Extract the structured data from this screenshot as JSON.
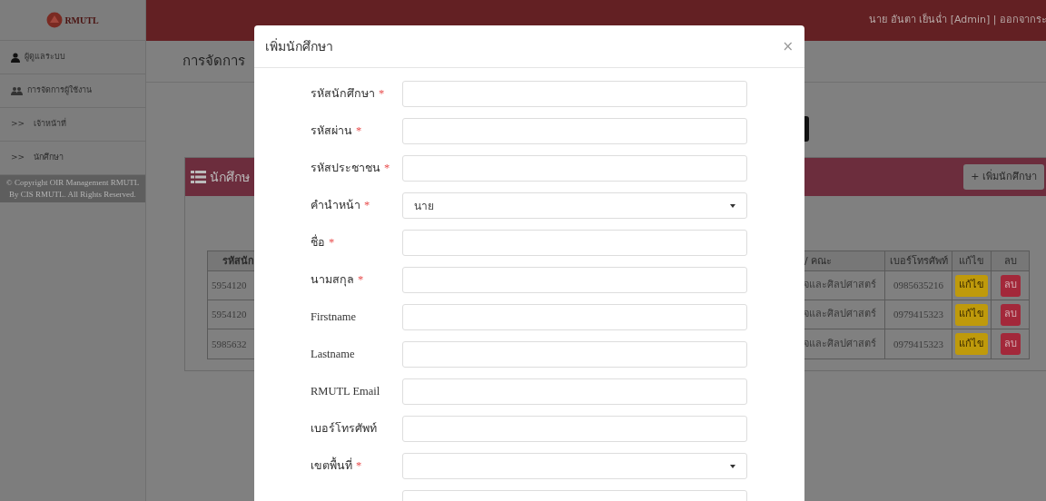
{
  "header": {
    "logo_text": "RMUTL",
    "user": "นาย อันตา เย็นฉ่ำ [Admin] | ออกจากระ"
  },
  "sidebar": {
    "items": [
      {
        "label": "ผู้ดูแลระบบ",
        "kind": "user"
      },
      {
        "label": "การจัดการผู้ใช้งาน",
        "kind": "users"
      },
      {
        "label": "เจ้าหน้าที่",
        "kind": "sub",
        "prefix": ">>"
      },
      {
        "label": "นักศึกษา",
        "kind": "sub",
        "prefix": ">>"
      }
    ],
    "copyright": "© Copyright OIR Management RMUTL By CIS RMUTL. All Rights Reserved."
  },
  "page": {
    "title": "การจัดการ"
  },
  "panel": {
    "title": "นักศึกษ",
    "add_button": "+ เพิ่มนักศึกษา",
    "table": {
      "columns": [
        "รหัสนัก",
        "/ คณะ",
        "เบอร์โทรศัพท์",
        "แก้ไข",
        "ลบ"
      ],
      "rows": [
        {
          "id": "5954120",
          "faculty": "จและศิลปศาสตร์",
          "phone": "0985635216",
          "edit": "แก้ไข",
          "delete": "ลบ"
        },
        {
          "id": "5954120",
          "faculty": "จและศิลปศาสตร์",
          "phone": "0979415323",
          "edit": "แก้ไข",
          "delete": "ลบ"
        },
        {
          "id": "5985632",
          "faculty": "จและศิลปศาสตร์",
          "phone": "0979415323",
          "edit": "แก้ไข",
          "delete": "ลบ"
        }
      ]
    }
  },
  "modal": {
    "title": "เพิ่มนักศึกษา",
    "close": "×",
    "fields": [
      {
        "label": "รหัสนักศึกษา",
        "required_mark": "*",
        "kind": "text"
      },
      {
        "label": "รหัสผ่าน",
        "required_mark": "*",
        "kind": "text"
      },
      {
        "label": "รหัสประชาชน",
        "required_mark": "*",
        "kind": "text"
      },
      {
        "label": "คำนำหน้า",
        "required_mark": "*",
        "kind": "select",
        "value": "นาย"
      },
      {
        "label": "ชื่อ",
        "required_mark": "*",
        "kind": "text"
      },
      {
        "label": "นามสกุล",
        "required_mark": "*",
        "kind": "text"
      },
      {
        "label": "Firstname",
        "kind": "text"
      },
      {
        "label": "Lastname",
        "kind": "text"
      },
      {
        "label": "RMUTL Email",
        "kind": "text"
      },
      {
        "label": "เบอร์โทรศัพท์",
        "kind": "text"
      },
      {
        "label": "เขตพื้นที่",
        "required_mark": "*",
        "kind": "select"
      },
      {
        "kind": "text"
      }
    ]
  }
}
